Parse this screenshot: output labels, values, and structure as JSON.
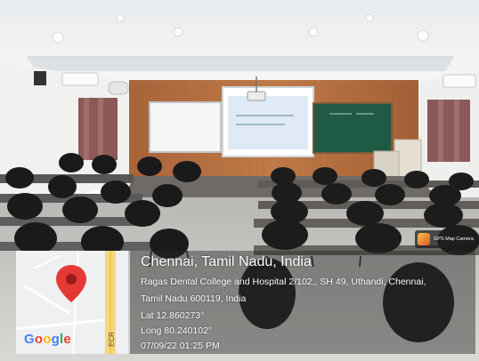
{
  "photo": {
    "description": "classroom with projector screen, whiteboard, chalkboard and rows of black chairs"
  },
  "gps_badge": {
    "label": "GPS Map Camera"
  },
  "map": {
    "road_label": "ECR",
    "google_letters": [
      {
        "char": "G",
        "color": "#4285F4"
      },
      {
        "char": "o",
        "color": "#EA4335"
      },
      {
        "char": "o",
        "color": "#FBBC05"
      },
      {
        "char": "g",
        "color": "#4285F4"
      },
      {
        "char": "l",
        "color": "#34A853"
      },
      {
        "char": "e",
        "color": "#EA4335"
      }
    ],
    "pin_color": "#E53935"
  },
  "location": {
    "city_line": "Chennai, Tamil Nadu, India",
    "address_line1": "Ragas Dental College and Hospital 2/102,, SH 49, Uthandi, Chennai,",
    "address_line2": "Tamil Nadu 600119, India",
    "lat": "Lat 12.860273°",
    "long": "Long 80.240102°",
    "datetime": "07/09/22 01:25 PM"
  }
}
